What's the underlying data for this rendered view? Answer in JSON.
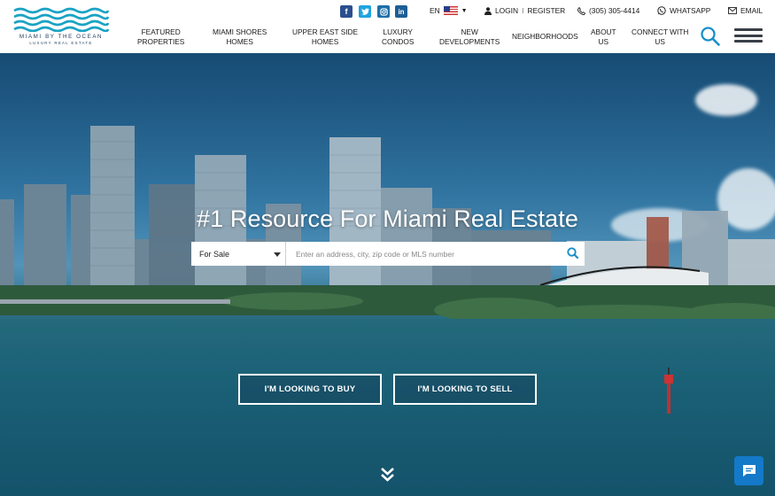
{
  "logo": {
    "name": "MIAMI BY THE OCEAN",
    "tagline": "LUXURY REAL ESTATE",
    "wave_color": "#1aa3c4"
  },
  "topbar": {
    "social": [
      {
        "icon": "facebook-icon",
        "glyph": "f"
      },
      {
        "icon": "twitter-icon",
        "glyph": "t"
      },
      {
        "icon": "instagram-icon",
        "glyph": "◎"
      },
      {
        "icon": "linkedin-icon",
        "glyph": "in"
      }
    ],
    "language": "EN",
    "login": "LOGIN",
    "separator": "I",
    "register": "REGISTER",
    "phone": "(305) 305-4414",
    "whatsapp": "WHATSAPP",
    "email": "EMAIL"
  },
  "nav": {
    "items": [
      {
        "line1": "FEATURED",
        "line2": "PROPERTIES"
      },
      {
        "line1": "MIAMI SHORES",
        "line2": "HOMES"
      },
      {
        "line1": "UPPER EAST SIDE",
        "line2": "HOMES"
      },
      {
        "line1": "LUXURY",
        "line2": "CONDOS"
      },
      {
        "line1": "NEW",
        "line2": "DEVELOPMENTS"
      },
      {
        "line1": "NEIGHBORHOODS",
        "line2": ""
      },
      {
        "line1": "ABOUT",
        "line2": "US"
      },
      {
        "line1": "CONNECT WITH",
        "line2": "US"
      }
    ]
  },
  "hero": {
    "title": "#1 Resource For Miami Real Estate",
    "search": {
      "type_selected": "For Sale",
      "placeholder": "Enter an address, city, zip code or MLS number"
    },
    "buy_label": "I'M LOOKING TO BUY",
    "sell_label": "I'M LOOKING TO SELL"
  },
  "colors": {
    "accent": "#1aa3c4",
    "chat": "#1479c9",
    "search_icon": "#1a8fc9"
  }
}
